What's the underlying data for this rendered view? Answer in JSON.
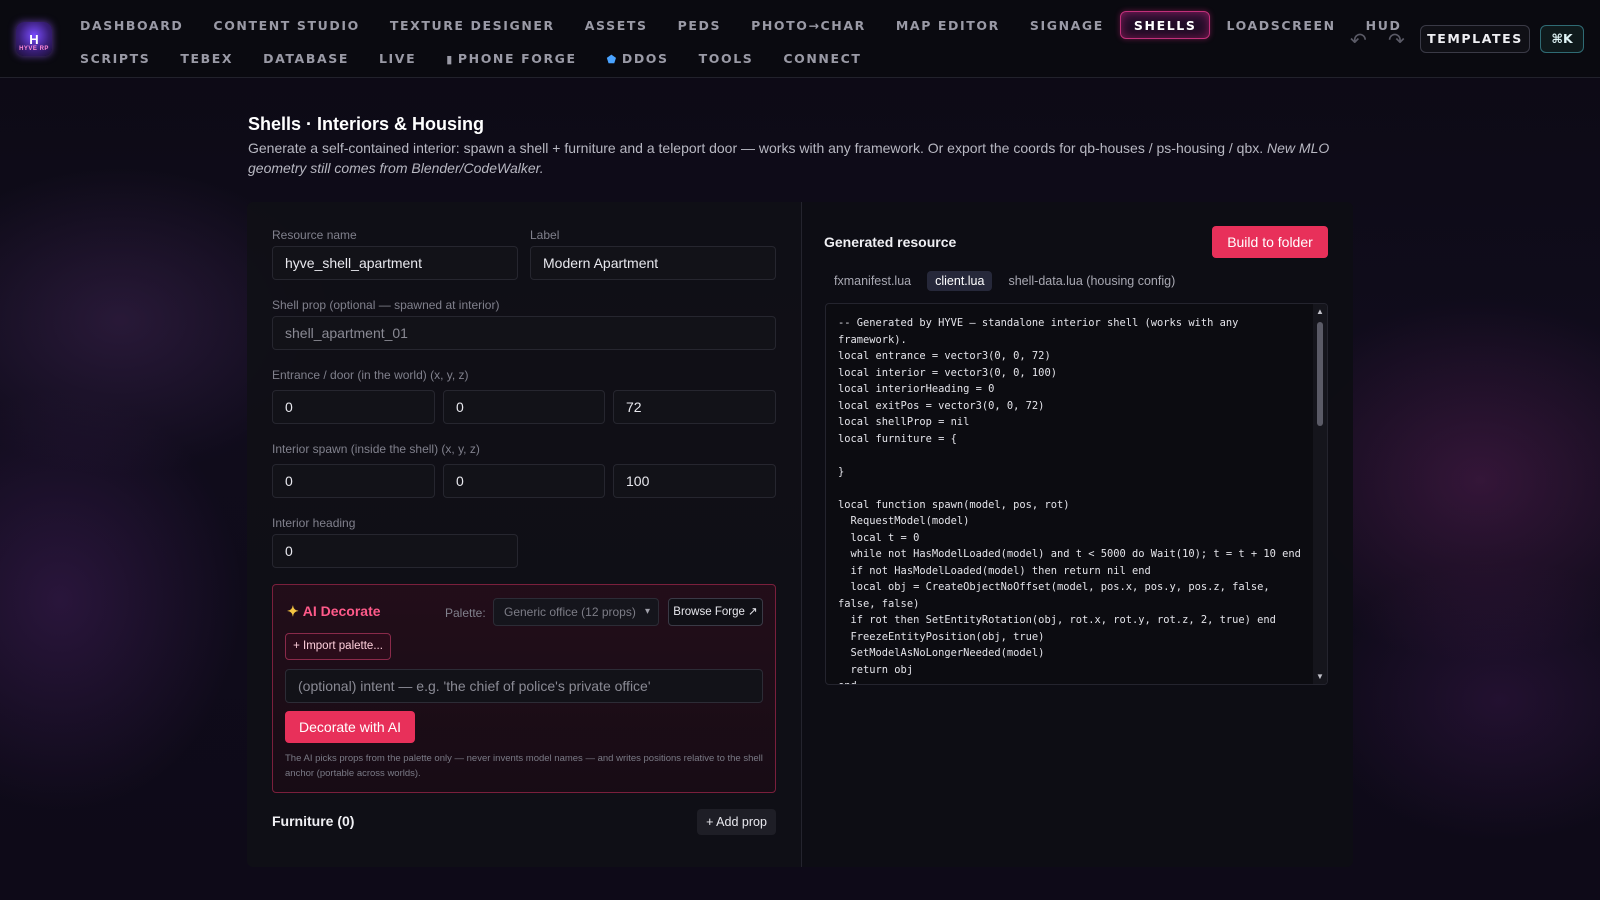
{
  "nav": {
    "logo_text": "H",
    "logo_sub": "HYVE RP",
    "row1": [
      "DASHBOARD",
      "CONTENT STUDIO",
      "TEXTURE DESIGNER",
      "ASSETS",
      "PEDS",
      "PHOTO→CHAR",
      "MAP EDITOR",
      "SIGNAGE",
      "SHELLS",
      "LOADSCREEN",
      "HUD"
    ],
    "row2": [
      "SCRIPTS",
      "TEBEX",
      "DATABASE",
      "LIVE",
      "PHONE FORGE",
      "DDOS",
      "TOOLS",
      "CONNECT"
    ],
    "active": "SHELLS",
    "templates_label": "TEMPLATES",
    "cmdk_label": "⌘K"
  },
  "page": {
    "title": "Shells · Interiors & Housing",
    "description": "Generate a self-contained interior: spawn a shell + furniture and a teleport door — works with any framework. Or export the coords for qb-houses / ps-housing / qbx.",
    "description_italic": "New MLO geometry still comes from Blender/CodeWalker."
  },
  "form": {
    "resource_name_label": "Resource name",
    "resource_name_value": "hyve_shell_apartment",
    "label_label": "Label",
    "label_value": "Modern Apartment",
    "shell_prop_label": "Shell prop (optional — spawned at interior)",
    "shell_prop_placeholder": "shell_apartment_01",
    "entrance_label": "Entrance / door (in the world) (x, y, z)",
    "entrance": [
      "0",
      "0",
      "72"
    ],
    "interior_label": "Interior spawn (inside the shell) (x, y, z)",
    "interior": [
      "0",
      "0",
      "100"
    ],
    "heading_label": "Interior heading",
    "heading_value": "0"
  },
  "ai": {
    "title": "AI Decorate",
    "palette_label": "Palette:",
    "palette_value": "Generic office (12 props)",
    "browse_label": "Browse Forge ↗",
    "import_label": "+ Import palette...",
    "intent_placeholder": "(optional) intent — e.g. 'the chief of police's private office'",
    "decorate_label": "Decorate with AI",
    "note": "The AI picks props from the palette only — never invents model names — and writes positions relative to the shell anchor (portable across worlds)."
  },
  "furniture": {
    "title": "Furniture (0)",
    "add_label": "+ Add prop"
  },
  "generated": {
    "title": "Generated resource",
    "build_label": "Build to folder",
    "tabs": [
      "fxmanifest.lua",
      "client.lua",
      "shell-data.lua (housing config)"
    ],
    "active_tab": "client.lua",
    "code": "-- Generated by HYVE — standalone interior shell (works with any framework).\nlocal entrance = vector3(0, 0, 72)\nlocal interior = vector3(0, 0, 100)\nlocal interiorHeading = 0\nlocal exitPos = vector3(0, 0, 72)\nlocal shellProp = nil\nlocal furniture = {\n\n}\n\nlocal function spawn(model, pos, rot)\n  RequestModel(model)\n  local t = 0\n  while not HasModelLoaded(model) and t < 5000 do Wait(10); t = t + 10 end\n  if not HasModelLoaded(model) then return nil end\n  local obj = CreateObjectNoOffset(model, pos.x, pos.y, pos.z, false, false, false)\n  if rot then SetEntityRotation(obj, rot.x, rot.y, rot.z, 2, true) end\n  FreezeEntityPosition(obj, true)\n  SetModelAsNoLongerNeeded(model)\n  return obj\nend"
  },
  "colors": {
    "accent": "#e8305a",
    "active_nav_border": "#c2307a",
    "ai_title": "#ff5a8a"
  }
}
